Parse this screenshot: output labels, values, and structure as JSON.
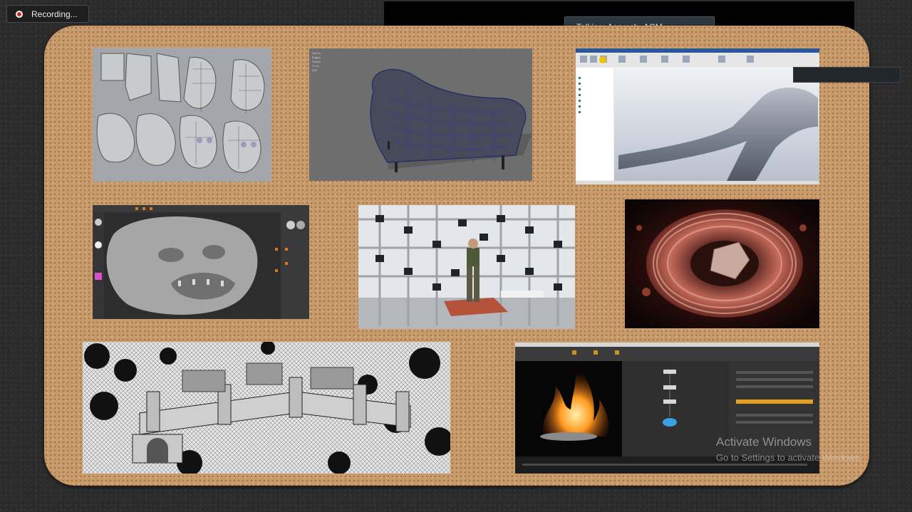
{
  "recording": {
    "label": "Recording..."
  },
  "talking": {
    "label": "Talking: Aaryesh_ACM"
  },
  "watermark": {
    "title": "Activate Windows",
    "subtitle": "Go to Settings to activate Windows."
  },
  "colors": {
    "board": "#c99a6a",
    "background": "#2b2b2b",
    "talk_bar": "#000000",
    "record_dot": "#dd2222"
  },
  "images": [
    {
      "name": "head-modeling-stages-image",
      "description_icon": "polygon-heads"
    },
    {
      "name": "tufted-sofa-wireframe-image",
      "description_icon": "sofa-wireframe"
    },
    {
      "name": "cad-pipe-model-image",
      "description_icon": "cad-software"
    },
    {
      "name": "zbrush-creature-sculpt-image",
      "description_icon": "zbrush-sculpt"
    },
    {
      "name": "photogrammetry-rig-image",
      "description_icon": "camera-rig"
    },
    {
      "name": "abstract-organic-render-image",
      "description_icon": "organic-render"
    },
    {
      "name": "castle-wireframe-image",
      "description_icon": "castle-wireframe"
    },
    {
      "name": "fire-simulation-software-image",
      "description_icon": "fire-node-editor"
    }
  ]
}
